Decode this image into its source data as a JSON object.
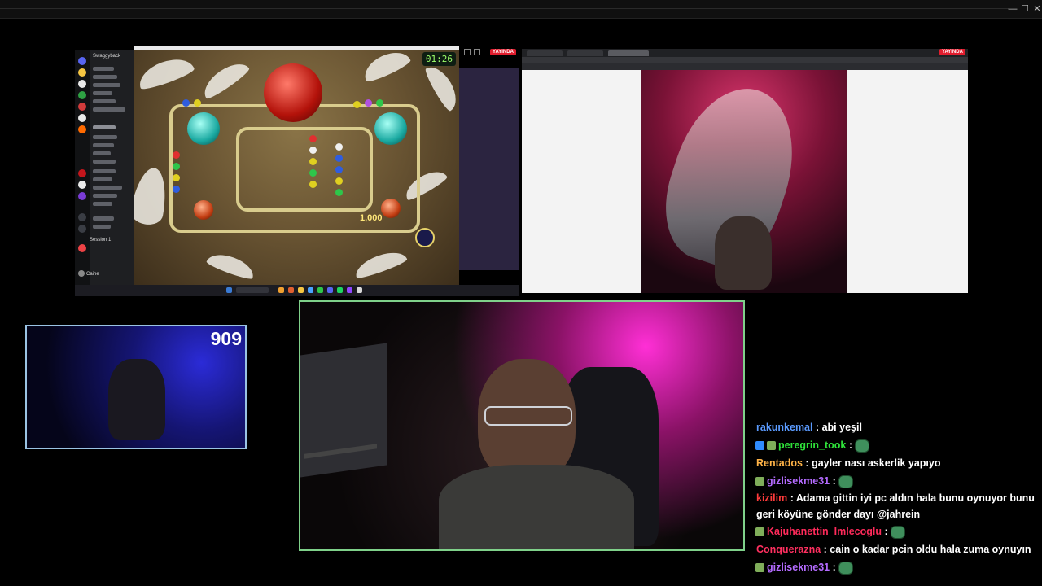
{
  "window": {
    "close_label": "✕",
    "max_label": "☐",
    "min_label": "—"
  },
  "discord": {
    "guild_name": "Swaggyback",
    "session_label": "Session 1",
    "user_label": "Caine"
  },
  "game": {
    "timer": "01:26",
    "score": "1,000"
  },
  "live_badge_left": "YAYINDA",
  "live_badge_right": "YAYINDA",
  "counter": "909",
  "chat": {
    "messages": [
      {
        "user": "rakunkemal",
        "color": "#5b9bff",
        "text": "abi yeşil",
        "emote": false
      },
      {
        "user": "peregrin_took",
        "color": "#2fe33a",
        "text": "",
        "emote": true
      },
      {
        "user": "Rentados",
        "color": "#ffb347",
        "text": "gayler nası askerlik yapıyo",
        "emote": false
      },
      {
        "user": "gizlisekme31",
        "color": "#b46bff",
        "text": "",
        "emote": true
      },
      {
        "user": "kizilim",
        "color": "#ff3b3b",
        "text": "Adama gittin iyi pc aldın hala bunu oynuyor bunu geri köyüne gönder dayı @jahrein",
        "emote": false
      },
      {
        "user": "Kajuhanettin_Imlecoglu",
        "color": "#ff2a5a",
        "text": "",
        "emote": true
      },
      {
        "user": "Conquerazna",
        "color": "#ff3060",
        "text": "cain o kadar pcin oldu hala zuma oynuyın",
        "emote": false
      },
      {
        "user": "gizlisekme31",
        "color": "#b46bff",
        "text": "",
        "emote": true
      }
    ]
  },
  "colors": {
    "accent_green": "#7fd18a",
    "accent_blue": "#9ac3e3",
    "live_red": "#e11d2e"
  }
}
